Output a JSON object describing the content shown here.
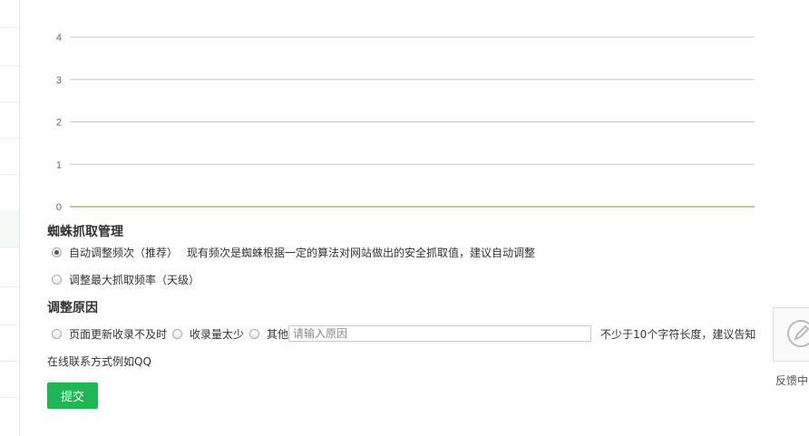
{
  "chart_data": {
    "type": "line",
    "y_ticks": [
      "4",
      "3",
      "2",
      "1",
      "0"
    ],
    "ylim": [
      0,
      4
    ],
    "series": [
      {
        "values": [
          0,
          0
        ],
        "color": "#5cab2a"
      }
    ],
    "grid": true
  },
  "spider": {
    "title": "蜘蛛抓取管理",
    "options": [
      {
        "label": "自动调整频次（推荐）",
        "desc": "现有频次是蜘蛛根据一定的算法对网站做出的安全抓取值，建议自动调整",
        "checked": true
      },
      {
        "label": "调整最大抓取频率（天级）",
        "desc": "",
        "checked": false
      }
    ]
  },
  "reason": {
    "title": "调整原因",
    "options": [
      "页面更新收录不及时",
      "收录量太少",
      "其他"
    ],
    "input_placeholder": "请输入原因",
    "hint_line1": "不少于10个字符长度，建议告知",
    "hint_line2": "在线联系方式例如QQ"
  },
  "submit_label": "提交",
  "feedback_label": "反馈中",
  "colors": {
    "accent": "#1fb754",
    "chart_line": "#5cab2a",
    "grid": "#c8c8c8"
  }
}
